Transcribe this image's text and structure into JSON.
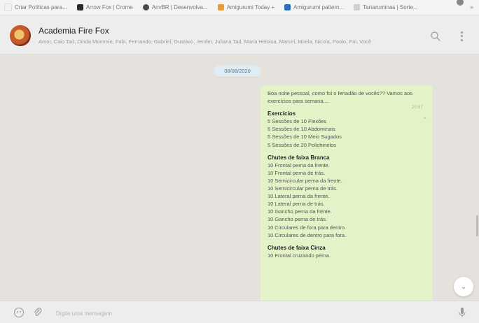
{
  "bookmarks": [
    {
      "label": "Criar Políticas para...",
      "color": "#f2f2f2"
    },
    {
      "label": "Arrow Fox | Crome",
      "color": "#2b2b2b"
    },
    {
      "label": "AnvBR | Desenvolva...",
      "color": "#4a4a4a"
    },
    {
      "label": "Amigurumi Today +",
      "color": "#e99b3a"
    },
    {
      "label": "Amigurumi pattern...",
      "color": "#2a6fb5"
    },
    {
      "label": "Tartaruminas | Sorte...",
      "color": "#cfcfcf"
    }
  ],
  "bookmarks_more": "»",
  "header": {
    "title": "Academia Fire Fox",
    "participants": "Amor, Caio Tad, Dinda Mommie, Fabi, Fernando, Gabriel, Gustavo, Jenifer, Juliana Tad, Maria Heloisa, Marcel, Mirela, Nicola, Paolo, Pai, Você",
    "search_icon": "search-icon",
    "menu_icon": "kebab-menu-icon"
  },
  "chat": {
    "date": "08/08/2020",
    "message": {
      "greeting": "Boa noite pessoal, como foi o feriadão de vocês?? Vamos aos exercícios para semana....",
      "time": "20:57",
      "sections": [
        {
          "title": "Exercícios",
          "lines": [
            "5 Sessões de 10 Flexões",
            "5 Sessões de 10 Abdominais",
            "5 Sessões de 10 Meio Sugados",
            "5 Sessões de 20 Polichinelos"
          ]
        },
        {
          "title": "Chutes de faixa Branca",
          "lines": [
            "10 Frontal perna da frente.",
            "10 Frontal perna de trás.",
            "10 Semicircular perna da frente.",
            "10 Semicircular perna de trás.",
            "10 Lateral perna da frente.",
            "10 Lateral perna de trás.",
            "10 Gancho perna da frente.",
            "10 Gancho perna de trás.",
            "10 Circulares de fora para dentro.",
            "10 Circulares de dentro para fora."
          ]
        },
        {
          "title": "Chutes de faixa Cinza",
          "lines": [
            "10 Frontal cruzando perna."
          ]
        }
      ]
    }
  },
  "composer": {
    "placeholder": "Digite uma mensagem",
    "emoji_icon": "emoji-icon",
    "attach_icon": "paperclip-icon",
    "mic_icon": "microphone-icon"
  },
  "colors": {
    "outgoing_bubble": "#e3f3c7",
    "chat_background": "#e5e1dc",
    "date_chip": "#e0ecf4"
  }
}
